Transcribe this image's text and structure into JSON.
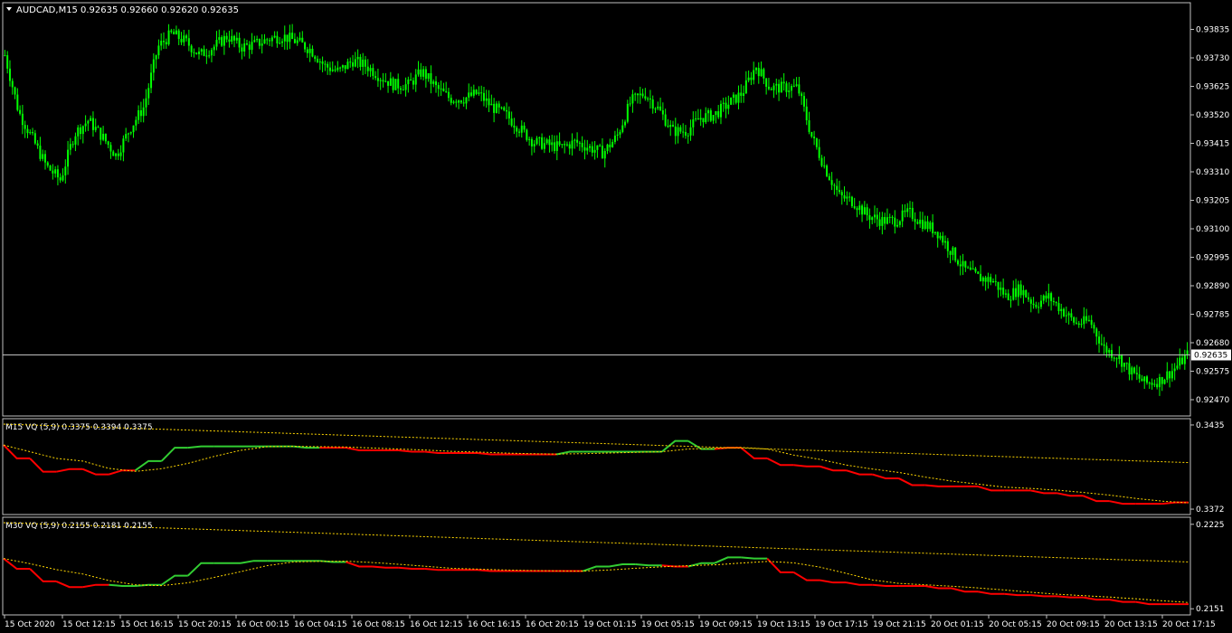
{
  "chart_data": {
    "type": "line",
    "main": {
      "title": "AUDCAD,M15",
      "ohlc": "0.92635 0.92660 0.92620 0.92635",
      "ylim": [
        0.9242,
        0.9392
      ],
      "y_ticks": [
        "0.93835",
        "0.93730",
        "0.93625",
        "0.93520",
        "0.93415",
        "0.93310",
        "0.93205",
        "0.93100",
        "0.92995",
        "0.92890",
        "0.92785",
        "0.92680",
        "0.92575",
        "0.92470"
      ],
      "current_price": "0.92635",
      "close_series": [
        0.9374,
        0.9353,
        0.9343,
        0.9333,
        0.9328,
        0.9345,
        0.935,
        0.9344,
        0.9337,
        0.9347,
        0.9355,
        0.9377,
        0.9382,
        0.9379,
        0.9374,
        0.9377,
        0.9381,
        0.9377,
        0.9378,
        0.938,
        0.9381,
        0.9379,
        0.9376,
        0.937,
        0.9368,
        0.9372,
        0.937,
        0.9366,
        0.9363,
        0.9363,
        0.9368,
        0.9362,
        0.9358,
        0.9358,
        0.936,
        0.9355,
        0.9352,
        0.9347,
        0.9342,
        0.9341,
        0.934,
        0.9342,
        0.934,
        0.9338,
        0.9344,
        0.9357,
        0.936,
        0.9354,
        0.9346,
        0.9346,
        0.9351,
        0.9352,
        0.9356,
        0.936,
        0.937,
        0.9362,
        0.9362,
        0.9362,
        0.9344,
        0.9332,
        0.9322,
        0.932,
        0.9315,
        0.9313,
        0.9313,
        0.9316,
        0.9312,
        0.9309,
        0.9302,
        0.9295,
        0.9292,
        0.9291,
        0.9285,
        0.9288,
        0.9282,
        0.9285,
        0.928,
        0.9275,
        0.9276,
        0.9266,
        0.9263,
        0.9257,
        0.9253,
        0.9254,
        0.9258,
        0.92635
      ]
    },
    "panels": [
      {
        "label": "M15 VQ (5,9) 0.3375 0.3394 0.3375",
        "y_ticks": [
          "0.3435",
          "0.3372"
        ],
        "ylim": [
          0.337,
          0.3437
        ],
        "series": [
          0.342,
          0.341,
          0.34,
          0.3402,
          0.3398,
          0.3401,
          0.3408,
          0.3418,
          0.3419,
          0.3419,
          0.3419,
          0.3419,
          0.3418,
          0.3418,
          0.3416,
          0.3416,
          0.3415,
          0.3414,
          0.3414,
          0.3413,
          0.3413,
          0.3413,
          0.3415,
          0.3415,
          0.3415,
          0.3415,
          0.3423,
          0.3417,
          0.3418,
          0.341,
          0.3405,
          0.3404,
          0.3401,
          0.3398,
          0.3395,
          0.339,
          0.3389,
          0.3389,
          0.3386,
          0.3386,
          0.3384,
          0.3382,
          0.3378,
          0.3376,
          0.3376,
          0.3377
        ]
      },
      {
        "label": "M30 VQ (5,9) 0.2155 0.2181 0.2155",
        "y_ticks": [
          "0.2225",
          "0.2151"
        ],
        "ylim": [
          0.2148,
          0.2228
        ],
        "series": [
          0.2195,
          0.2186,
          0.2175,
          0.217,
          0.2172,
          0.2171,
          0.2172,
          0.218,
          0.2191,
          0.2191,
          0.2193,
          0.2193,
          0.2193,
          0.2192,
          0.2188,
          0.2187,
          0.2186,
          0.2185,
          0.2185,
          0.2184,
          0.2184,
          0.2184,
          0.2184,
          0.2188,
          0.219,
          0.2189,
          0.2188,
          0.2191,
          0.2196,
          0.2195,
          0.2183,
          0.2176,
          0.2174,
          0.2172,
          0.2171,
          0.2171,
          0.2169,
          0.2166,
          0.2164,
          0.2163,
          0.2162,
          0.2161,
          0.2159,
          0.2157,
          0.2155,
          0.2155
        ]
      }
    ],
    "x_ticks": [
      "15 Oct 2020",
      "15 Oct 12:15",
      "15 Oct 16:15",
      "15 Oct 20:15",
      "16 Oct 00:15",
      "16 Oct 04:15",
      "16 Oct 08:15",
      "16 Oct 12:15",
      "16 Oct 16:15",
      "16 Oct 20:15",
      "19 Oct 01:15",
      "19 Oct 05:15",
      "19 Oct 09:15",
      "19 Oct 13:15",
      "19 Oct 17:15",
      "19 Oct 21:15",
      "20 Oct 01:15",
      "20 Oct 05:15",
      "20 Oct 09:15",
      "20 Oct 13:15",
      "20 Oct 17:15"
    ],
    "colors": {
      "background": "#000000",
      "candles": "#00ff00",
      "vq_up": "#32cd32",
      "vq_down": "#ff0000",
      "signal": "#ffd700",
      "text": "#ffffff",
      "price_line": "#c0c0c0"
    }
  }
}
